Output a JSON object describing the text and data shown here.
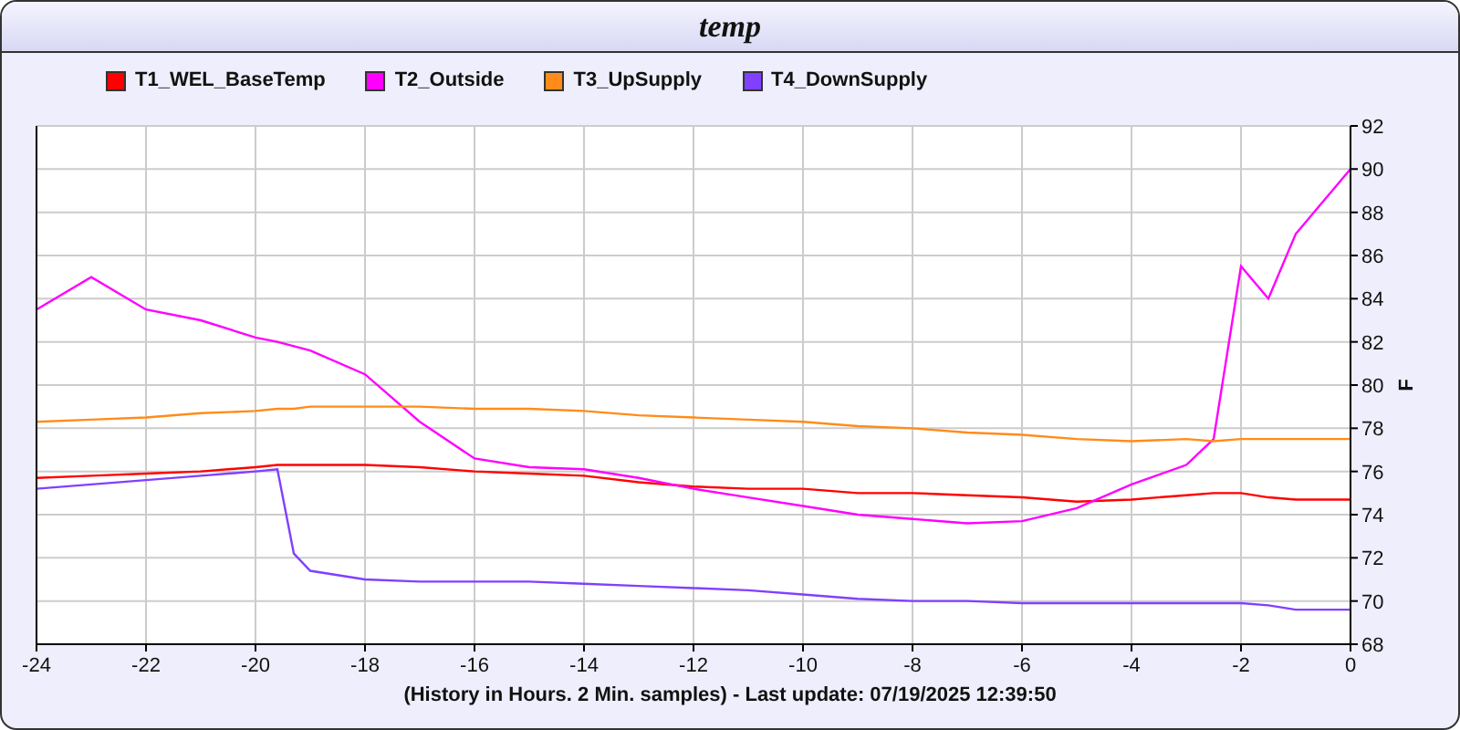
{
  "chart_data": {
    "type": "line",
    "title": "temp",
    "xlabel": "(History in Hours. 2 Min. samples) - Last update: 07/19/2025 12:39:50",
    "ylabel": "F",
    "x": [
      -24,
      -23,
      -22,
      -21,
      -20,
      -19.6,
      -19.3,
      -19,
      -18,
      -17,
      -16,
      -15,
      -14,
      -13,
      -12,
      -11,
      -10,
      -9,
      -8,
      -7,
      -6,
      -5,
      -4,
      -3,
      -2.5,
      -2,
      -1.5,
      -1,
      -0.5,
      0
    ],
    "series": [
      {
        "name": "T1_WEL_BaseTemp",
        "color": "#ff0000",
        "values": [
          75.7,
          75.8,
          75.9,
          76.0,
          76.2,
          76.3,
          76.3,
          76.3,
          76.3,
          76.2,
          76.0,
          75.9,
          75.8,
          75.5,
          75.3,
          75.2,
          75.2,
          75.0,
          75.0,
          74.9,
          74.8,
          74.6,
          74.7,
          74.9,
          75.0,
          75.0,
          74.8,
          74.7,
          74.7,
          74.7
        ]
      },
      {
        "name": "T2_Outside",
        "color": "#ff00ff",
        "values": [
          83.5,
          85,
          83.5,
          83,
          82.2,
          82,
          81.8,
          81.6,
          80.5,
          78.3,
          76.6,
          76.2,
          76.1,
          75.7,
          75.2,
          74.8,
          74.4,
          74.0,
          73.8,
          73.6,
          73.7,
          74.3,
          75.4,
          76.3,
          77.5,
          85.5,
          84,
          87,
          88.5,
          90
        ]
      },
      {
        "name": "T3_UpSupply",
        "color": "#ff8c1a",
        "values": [
          78.3,
          78.4,
          78.5,
          78.7,
          78.8,
          78.9,
          78.9,
          79.0,
          79.0,
          79.0,
          78.9,
          78.9,
          78.8,
          78.6,
          78.5,
          78.4,
          78.3,
          78.1,
          78.0,
          77.8,
          77.7,
          77.5,
          77.4,
          77.5,
          77.4,
          77.5,
          77.5,
          77.5,
          77.5,
          77.5
        ]
      },
      {
        "name": "T4_DownSupply",
        "color": "#8040ff",
        "values": [
          75.2,
          75.4,
          75.6,
          75.8,
          76.0,
          76.1,
          72.2,
          71.4,
          71.0,
          70.9,
          70.9,
          70.9,
          70.8,
          70.7,
          70.6,
          70.5,
          70.3,
          70.1,
          70.0,
          70.0,
          69.9,
          69.9,
          69.9,
          69.9,
          69.9,
          69.9,
          69.8,
          69.6,
          69.6,
          69.6
        ]
      }
    ],
    "xlim": [
      -24,
      0
    ],
    "ylim": [
      68,
      92
    ],
    "xticks": [
      -24,
      -22,
      -20,
      -18,
      -16,
      -14,
      -12,
      -10,
      -8,
      -6,
      -4,
      -2,
      0
    ],
    "yticks": [
      68,
      70,
      72,
      74,
      76,
      78,
      80,
      82,
      84,
      86,
      88,
      90,
      92
    ],
    "grid": true,
    "legend": "top"
  }
}
